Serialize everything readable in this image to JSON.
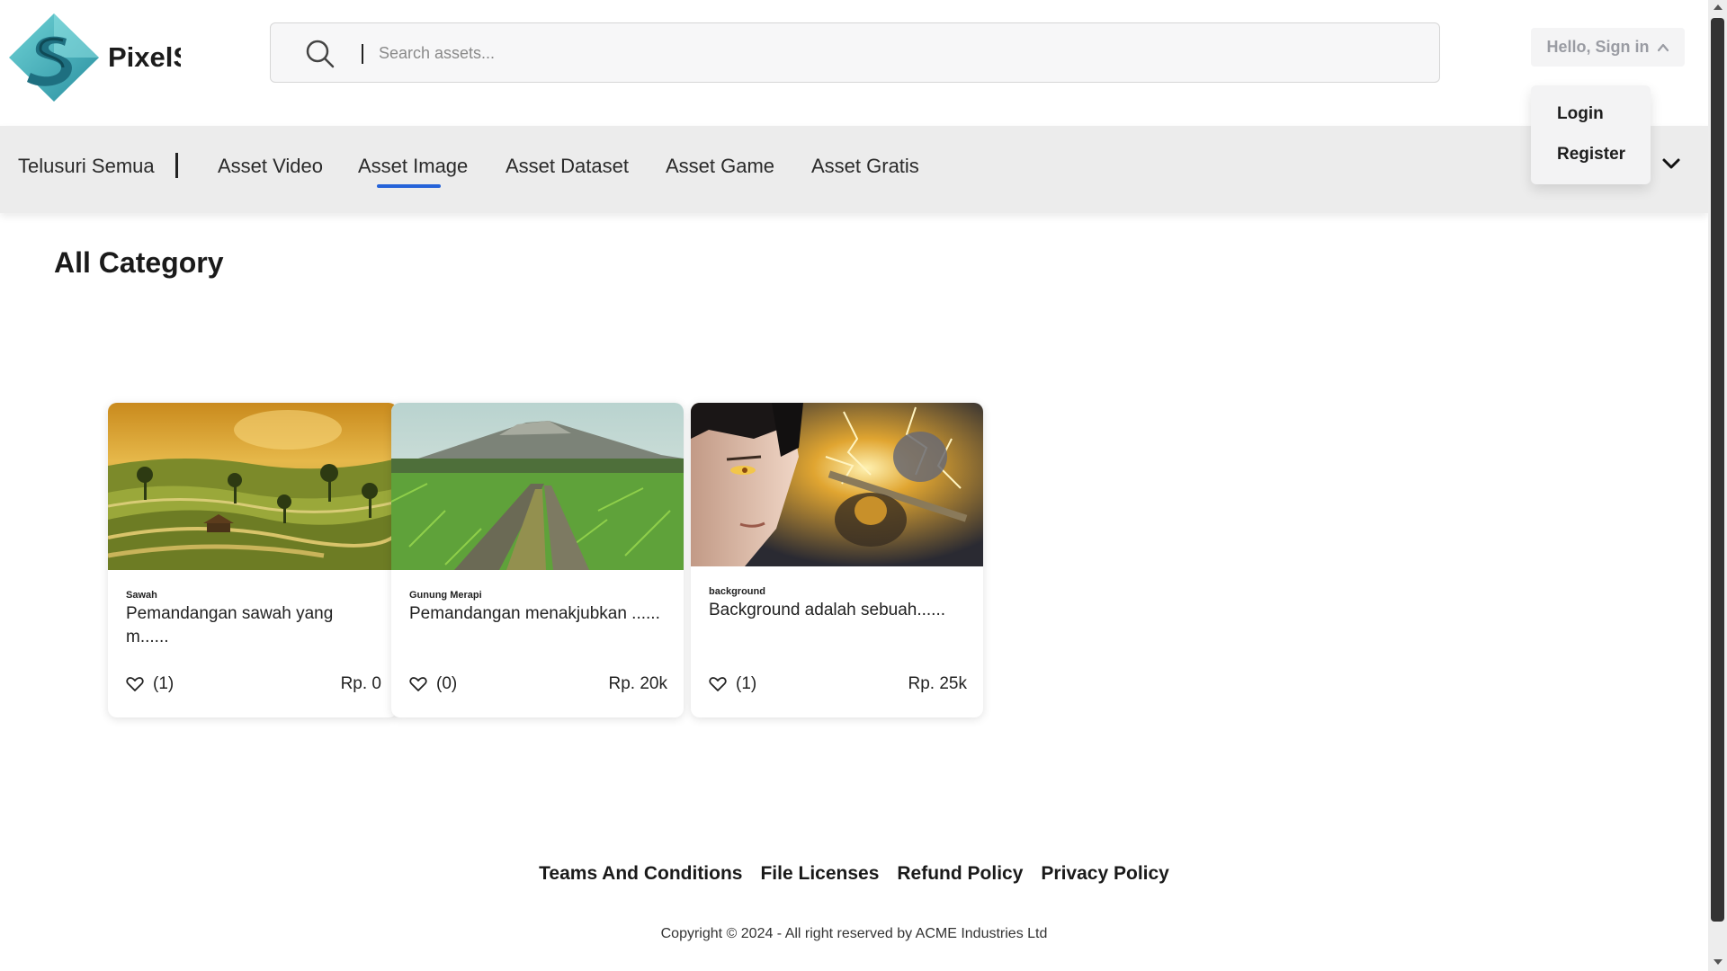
{
  "header": {
    "brand": "PixelS",
    "search_placeholder": "Search assets...",
    "signin_label": "Hello, Sign in"
  },
  "dropdown": {
    "items": [
      "Login",
      "Register"
    ]
  },
  "nav": {
    "browse_all": "Telusuri Semua",
    "items": [
      "Asset Video",
      "Asset Image",
      "Asset Dataset",
      "Asset Game",
      "Asset Gratis"
    ],
    "active": "Asset Image",
    "accent_color": "#2563d9"
  },
  "main": {
    "title": "All Category",
    "cards": [
      {
        "category": "Sawah",
        "title": "Pemandangan sawah yang m......",
        "likes": "(1)",
        "price": "Rp. 0"
      },
      {
        "category": "Gunung Merapi",
        "title": "Pemandangan menakjubkan ......",
        "likes": "(0)",
        "price": "Rp. 20k"
      },
      {
        "category": "background",
        "title": "Background adalah sebuah......",
        "likes": "(1)",
        "price": "Rp. 25k"
      }
    ]
  },
  "footer": {
    "links": [
      "Teams And Conditions",
      "File Licenses",
      "Refund Policy",
      "Privacy Policy"
    ],
    "copyright": "Copyright © 2024 - All right reserved by ACME Industries Ltd"
  },
  "icons": {
    "logo": "pixels-logo-icon",
    "search": "search-icon",
    "signin_chevron": "chevron-up-icon",
    "nav_chevron": "chevron-down-icon",
    "like": "heart-icon"
  }
}
